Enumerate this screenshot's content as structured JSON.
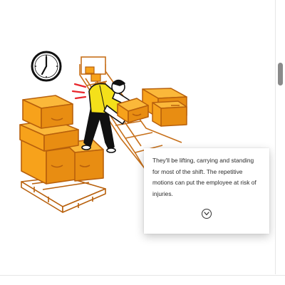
{
  "card": {
    "text": "They'll be lifting, carrying and standing for most of the shift. The repetitive motions can put the employee at risk of injuries.",
    "expand_icon": "chevron-down-icon"
  },
  "illustration": {
    "subject": "warehouse-worker-lifting-boxes",
    "icons": [
      "clock-icon",
      "strain-lines-icon"
    ]
  },
  "colors": {
    "box_orange": "#f7a21b",
    "box_outline": "#b8600c",
    "vest_yellow": "#f4e01a",
    "strain_red": "#e8262c",
    "ink": "#111111"
  }
}
